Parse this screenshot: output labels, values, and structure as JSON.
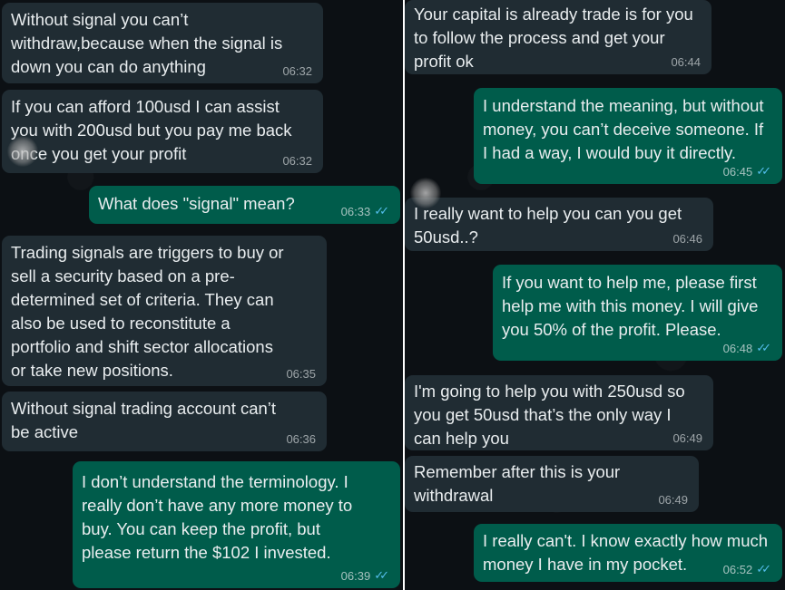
{
  "left_panel": {
    "messages": [
      {
        "dir": "in",
        "text": "Without signal you can’t\nwithdraw,because when the signal is\ndown you can do anything",
        "time": "06:32"
      },
      {
        "dir": "in",
        "text": "If you can afford 100usd I can assist\nyou with 200usd but you pay me back\nonce you get your profit",
        "time": "06:32"
      },
      {
        "dir": "out",
        "text": "What does \"signal\" mean?",
        "time": "06:33",
        "read": "✓✓"
      },
      {
        "dir": "in",
        "text": "Trading signals are triggers to buy or\nsell a security based on a pre-\ndetermined set of criteria. They can\nalso be used to reconstitute a\nportfolio and shift sector allocations\nor take new positions.",
        "time": "06:35"
      },
      {
        "dir": "in",
        "text": "Without signal trading account can’t\nbe active",
        "time": "06:36"
      },
      {
        "dir": "out",
        "text": "I don’t understand the terminology. I\nreally don’t have any more money to\nbuy. You can keep the profit, but\nplease return the $102 I invested.",
        "time": "06:39",
        "read": "✓✓"
      }
    ]
  },
  "right_panel": {
    "messages": [
      {
        "dir": "in",
        "text": "Your capital is already trade is for you\nto follow the process and get your\nprofit ok",
        "time": "06:44"
      },
      {
        "dir": "out",
        "text": "I understand the meaning, but without\nmoney, you can’t deceive someone. If\nI had a way, I would buy it directly.",
        "time": "06:45",
        "read": "✓✓"
      },
      {
        "dir": "in",
        "text": "I really want to help you can you get\n50usd..?",
        "time": "06:46"
      },
      {
        "dir": "out",
        "text": "If you want to help me, please first\nhelp me with this money. I will give\nyou 50% of the profit. Please.",
        "time": "06:48",
        "read": "✓✓"
      },
      {
        "dir": "in",
        "text": "I'm going to help you with 250usd so\nyou get 50usd that’s the only way I\ncan help you",
        "time": "06:49"
      },
      {
        "dir": "in",
        "text": "Remember after this is your\nwithdrawal",
        "time": "06:49"
      },
      {
        "dir": "out",
        "text": "I really can't. I know exactly how much\nmoney I have in my pocket.",
        "time": "06:52",
        "read": "✓✓"
      }
    ]
  },
  "colors": {
    "background": "#0c1014",
    "incoming_bubble": "#202c33",
    "outgoing_bubble": "#005c4b",
    "text": "#e9edef",
    "read_ticks": "#53bdeb"
  }
}
